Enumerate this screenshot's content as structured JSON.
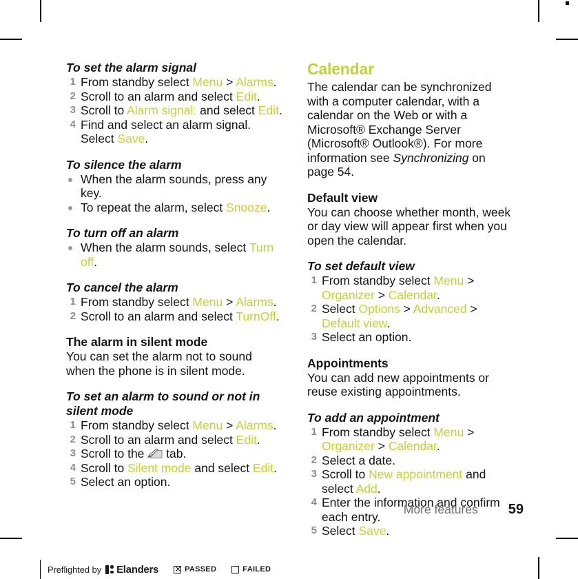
{
  "document": {
    "footer": {
      "section_label": "More features",
      "page_number": "59"
    },
    "preflight": {
      "prefix": "Preflighted by",
      "brand": "Elanders",
      "passed_label": "PASSED",
      "failed_label": "FAILED"
    }
  },
  "colors": {
    "accent_green": "#c3d22f",
    "body_text": "#141414",
    "marker_gray": "#8c8c8c"
  },
  "left_column": {
    "s1": {
      "heading": "To set the alarm signal",
      "steps": [
        {
          "n": "1",
          "pre": "From standby select ",
          "hl1": "Menu",
          "mid": " > ",
          "hl2": "Alarms",
          "post": "."
        },
        {
          "n": "2",
          "pre": "Scroll to an alarm and select ",
          "hl1": "Edit",
          "mid": "",
          "hl2": "",
          "post": "."
        },
        {
          "n": "3",
          "pre": "Scroll to ",
          "hl1": "Alarm signal:",
          "mid": " and select ",
          "hl2": "Edit",
          "post": "."
        },
        {
          "n": "4",
          "pre": "Find and select an alarm signal. Select ",
          "hl1": "Save",
          "mid": "",
          "hl2": "",
          "post": "."
        }
      ]
    },
    "s2": {
      "heading": "To silence the alarm",
      "bullets": [
        {
          "pre": "When the alarm sounds, press any key.",
          "hl1": "",
          "post": ""
        },
        {
          "pre": "To repeat the alarm, select ",
          "hl1": "Snooze",
          "post": "."
        }
      ]
    },
    "s3": {
      "heading": "To turn off an alarm",
      "bullets": [
        {
          "pre": "When the alarm sounds, select ",
          "hl1": "Turn off",
          "post": "."
        }
      ]
    },
    "s4": {
      "heading": "To cancel the alarm",
      "steps": [
        {
          "n": "1",
          "pre": "From standby select ",
          "hl1": "Menu",
          "mid": " > ",
          "hl2": "Alarms",
          "post": "."
        },
        {
          "n": "2",
          "pre": "Scroll to an alarm and select ",
          "hl1": "TurnOff",
          "mid": "",
          "hl2": "",
          "post": "."
        }
      ]
    },
    "s5": {
      "heading": "The alarm in silent mode",
      "body": "You can set the alarm not to sound when the phone is in silent mode."
    },
    "s6": {
      "heading": "To set an alarm to sound or not in silent mode",
      "steps": [
        {
          "n": "1",
          "pre": "From standby select ",
          "hl1": "Menu",
          "mid": " > ",
          "hl2": "Alarms",
          "post": "."
        },
        {
          "n": "2",
          "pre": "Scroll to an alarm and select ",
          "hl1": "Edit",
          "mid": "",
          "hl2": "",
          "post": "."
        },
        {
          "n": "4",
          "pre": "Scroll to ",
          "hl1": "Silent mode",
          "mid": " and select ",
          "hl2": "Edit",
          "post": "."
        },
        {
          "n": "5",
          "pre": "Select an option.",
          "hl1": "",
          "mid": "",
          "hl2": "",
          "post": ""
        }
      ],
      "icon_step": {
        "n": "3",
        "pre": "Scroll to the ",
        "icon": "pencil-tab-icon",
        "post": " tab."
      }
    }
  },
  "right_column": {
    "title": "Calendar",
    "intro_a": "The calendar can be synchronized with a computer calendar, with a calendar on the Web or with a Microsoft® Exchange Server (Microsoft® Outlook®). For more information see ",
    "intro_ref": "Synchronizing",
    "intro_b": " on page 54.",
    "s1": {
      "heading": "Default view",
      "body": "You can choose whether month, week or day view will appear first when you open the calendar."
    },
    "s2": {
      "heading": "To set default view",
      "steps": [
        {
          "n": "1",
          "pre": "From standby select ",
          "hl1": "Menu",
          "mid": " > ",
          "hl2": "Organizer",
          "mid2": " > ",
          "hl3": "Calendar",
          "post": "."
        },
        {
          "n": "2",
          "pre": "Select ",
          "hl1": "Options",
          "mid": " > ",
          "hl2": "Advanced",
          "mid2": " > ",
          "hl3": "Default view",
          "post": "."
        },
        {
          "n": "3",
          "pre": "Select an option.",
          "hl1": "",
          "mid": "",
          "hl2": "",
          "mid2": "",
          "hl3": "",
          "post": ""
        }
      ]
    },
    "s3": {
      "heading": "Appointments",
      "body": "You can add new appointments or reuse existing appointments."
    },
    "s4": {
      "heading": "To add an appointment",
      "steps": [
        {
          "n": "1",
          "pre": "From standby select ",
          "hl1": "Menu",
          "mid": " > ",
          "hl2": "Organizer",
          "mid2": " > ",
          "hl3": "Calendar",
          "post": "."
        },
        {
          "n": "2",
          "pre": "Select a date.",
          "hl1": "",
          "mid": "",
          "hl2": "",
          "mid2": "",
          "hl3": "",
          "post": ""
        },
        {
          "n": "3",
          "pre": "Scroll to ",
          "hl1": "New appointment",
          "mid": " and select ",
          "hl2": "Add",
          "mid2": "",
          "hl3": "",
          "post": "."
        },
        {
          "n": "4",
          "pre": "Enter the information and confirm each entry.",
          "hl1": "",
          "mid": "",
          "hl2": "",
          "mid2": "",
          "hl3": "",
          "post": ""
        },
        {
          "n": "5",
          "pre": "Select ",
          "hl1": "Save",
          "mid": "",
          "hl2": "",
          "mid2": "",
          "hl3": "",
          "post": "."
        }
      ]
    }
  }
}
